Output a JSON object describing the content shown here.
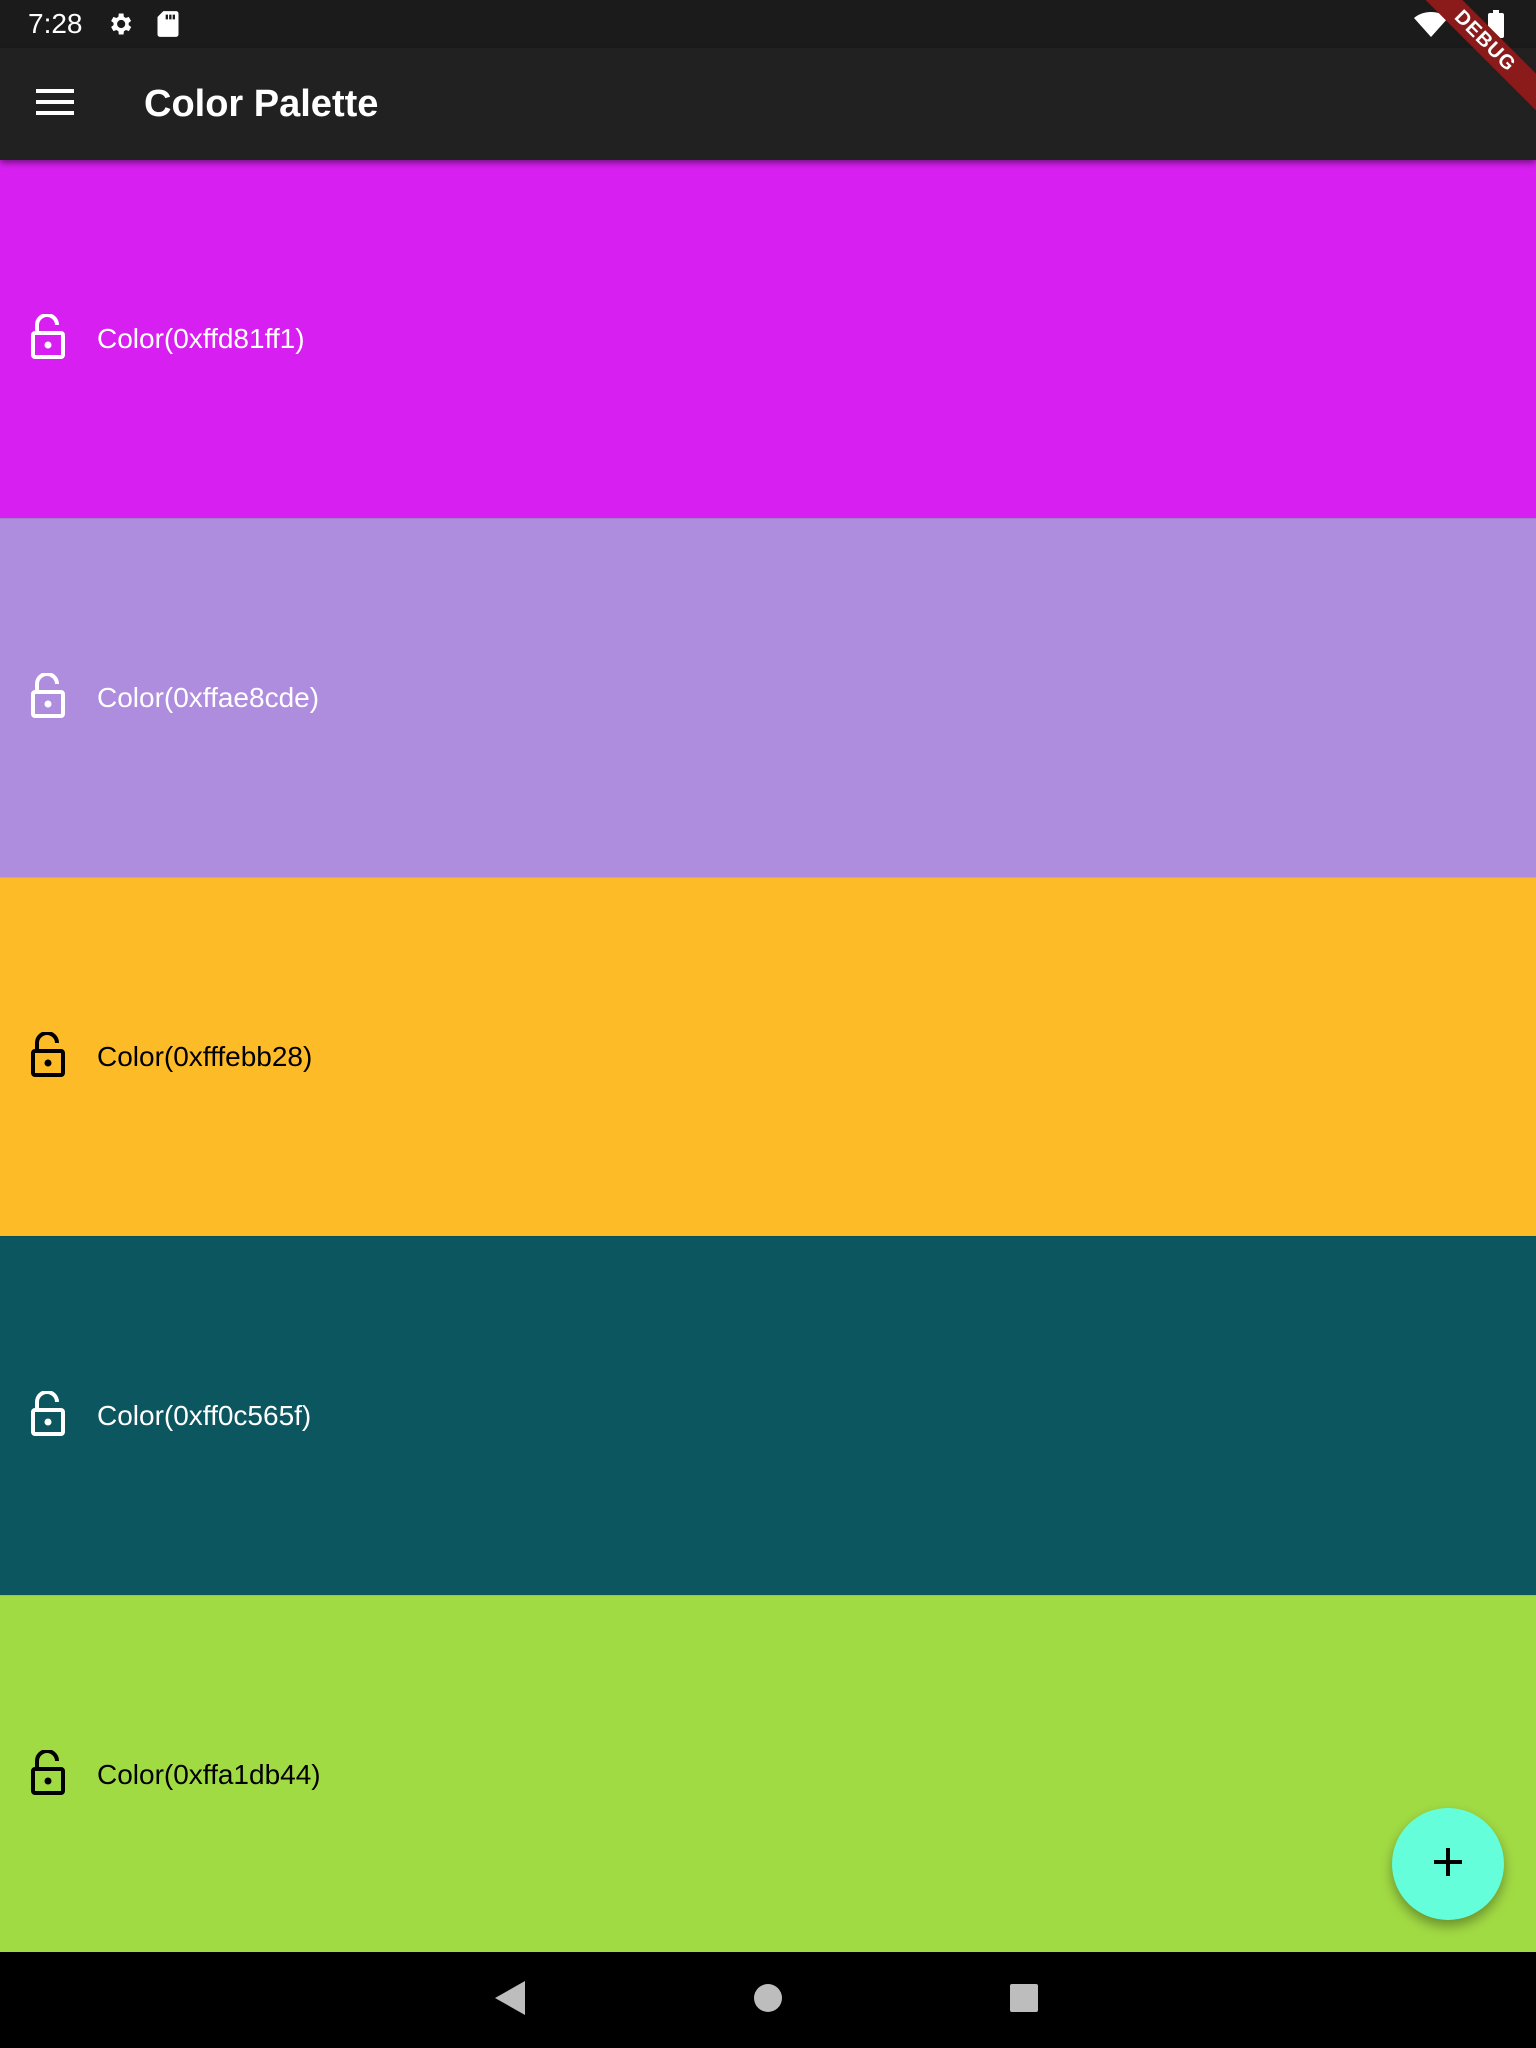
{
  "status_bar": {
    "time": "7:28",
    "icons": [
      "gear-icon",
      "sd-card-icon",
      "wifi-icon",
      "battery-icon"
    ]
  },
  "debug_banner": {
    "label": "DEBUG"
  },
  "app_bar": {
    "menu_icon": "hamburger-menu-icon",
    "title": "Color Palette"
  },
  "palette": {
    "colors": [
      {
        "label": "Color(0xffd81ff1)",
        "hex": "#d81ff1",
        "text_color": "#ffffff",
        "locked": false
      },
      {
        "label": "Color(0xffae8cde)",
        "hex": "#ae8cde",
        "text_color": "#ffffff",
        "locked": false
      },
      {
        "label": "Color(0xfffebb28)",
        "hex": "#febb28",
        "text_color": "#000000",
        "locked": false
      },
      {
        "label": "Color(0xff0c565f)",
        "hex": "#0c565f",
        "text_color": "#ffffff",
        "locked": false
      },
      {
        "label": "Color(0xffa1db44)",
        "hex": "#a1db44",
        "text_color": "#000000",
        "locked": false
      }
    ]
  },
  "fab": {
    "icon": "plus-icon",
    "color": "#64ffda"
  },
  "nav_bar": {
    "buttons": [
      "back-icon",
      "home-icon",
      "recents-icon"
    ]
  },
  "theme": {
    "status_bar_bg": "#1b1b1b",
    "app_bar_bg": "#212121",
    "nav_bar_bg": "#000000"
  }
}
